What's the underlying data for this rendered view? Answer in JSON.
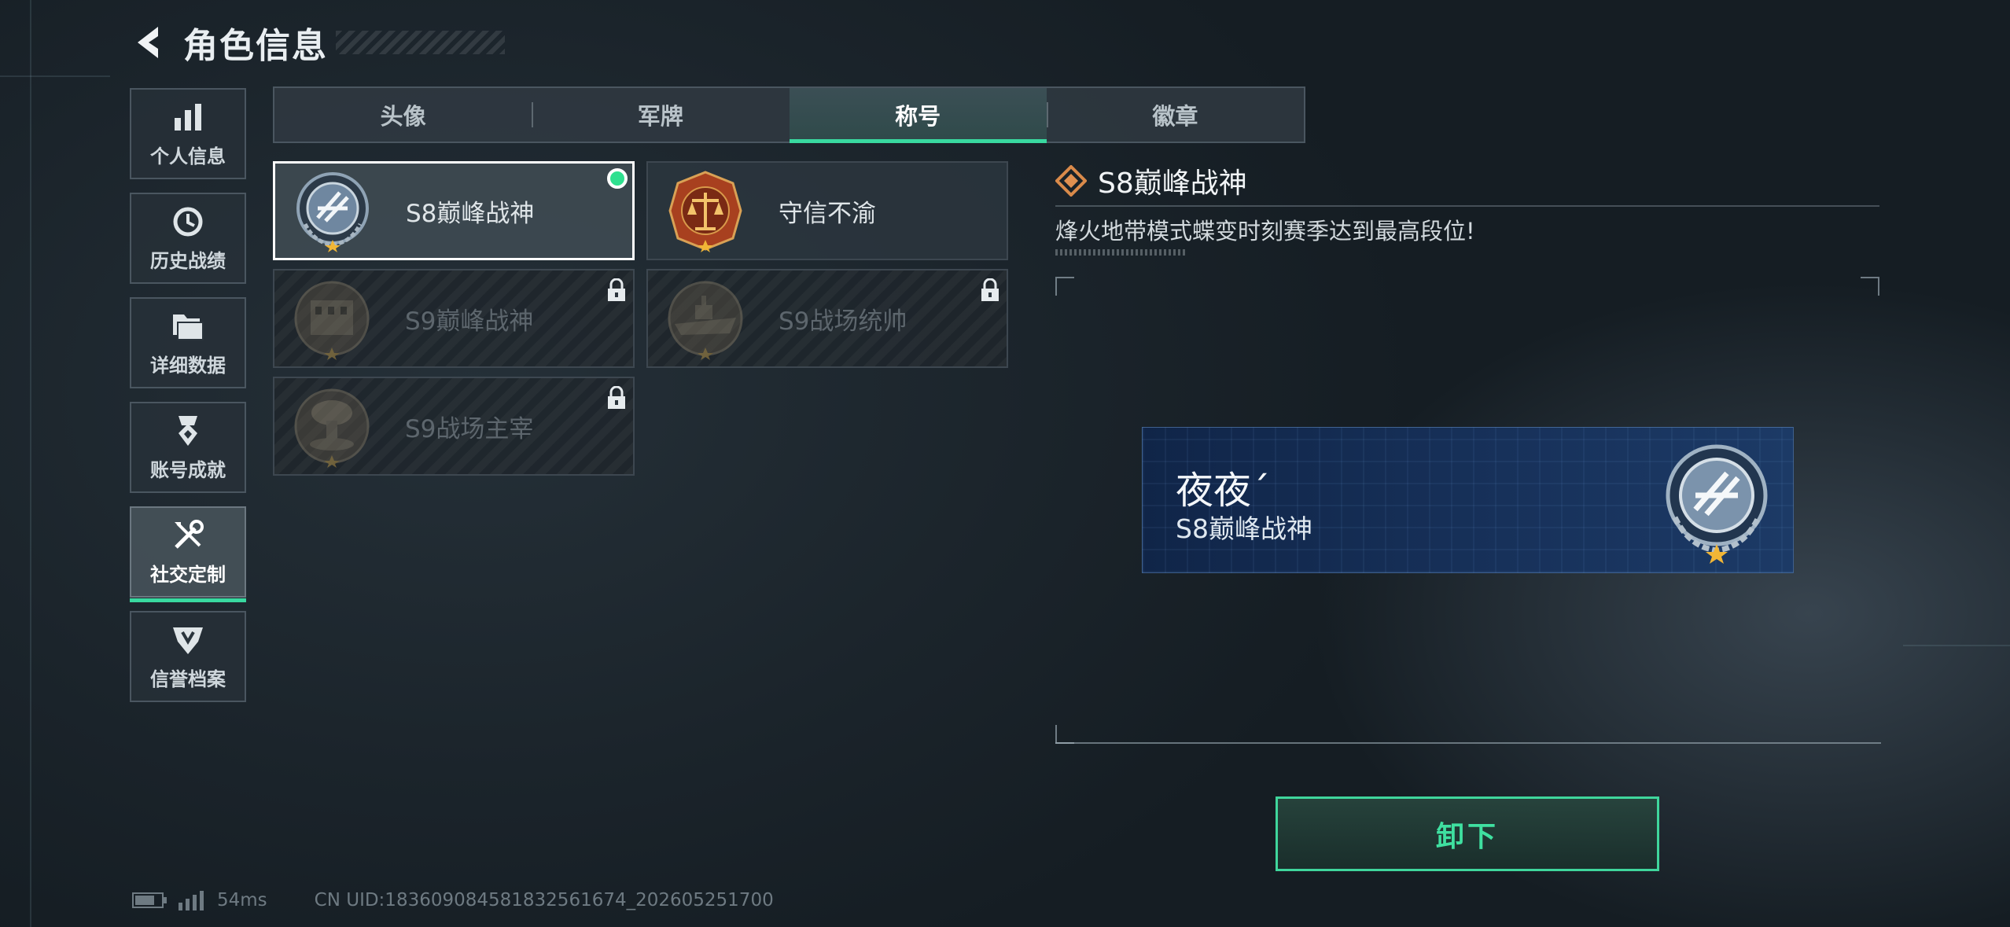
{
  "header": {
    "title": "角色信息",
    "back_icon": "back-arrow-icon"
  },
  "sidebar": {
    "items": [
      {
        "label": "个人信息",
        "icon": "bar-chart-icon",
        "active": false
      },
      {
        "label": "历史战绩",
        "icon": "history-clock-icon",
        "active": false
      },
      {
        "label": "详细数据",
        "icon": "folder-data-icon",
        "active": false
      },
      {
        "label": "账号成就",
        "icon": "achievement-medal-icon",
        "active": false
      },
      {
        "label": "社交定制",
        "icon": "tools-wrench-icon",
        "active": true
      },
      {
        "label": "信誉档案",
        "icon": "credit-shield-icon",
        "active": false
      }
    ]
  },
  "tabs": [
    {
      "label": "头像",
      "active": false
    },
    {
      "label": "军牌",
      "active": false
    },
    {
      "label": "称号",
      "active": true
    },
    {
      "label": "徽章",
      "active": false
    }
  ],
  "titles": [
    {
      "name": "S8巅峰战神",
      "state": "equipped",
      "emblem": "silver-laurel-emblem-icon"
    },
    {
      "name": "守信不渝",
      "state": "unlocked",
      "emblem": "scales-of-justice-emblem-icon"
    },
    {
      "name": "S9巅峰战神",
      "state": "locked",
      "emblem": "building-emblem-icon"
    },
    {
      "name": "S9战场统帅",
      "state": "locked",
      "emblem": "warship-emblem-icon"
    },
    {
      "name": "S9战场主宰",
      "state": "locked",
      "emblem": "mushroom-cloud-emblem-icon"
    }
  ],
  "detail": {
    "title": "S8巅峰战神",
    "description": "烽火地带模式蝶变时刻赛季达到最高段位!",
    "title_icon": "diamond-rank-icon"
  },
  "preview": {
    "player_name": "夜夜´",
    "title": "S8巅峰战神"
  },
  "action": {
    "unequip_label": "卸下"
  },
  "status_bar": {
    "ping": "54ms",
    "uid": "CN UID:1836090845818325616​74_202605251700"
  },
  "colors": {
    "accent": "#39d9a0",
    "equipped_dot": "#2fe08f",
    "nameplate_bg": "#17315a"
  }
}
